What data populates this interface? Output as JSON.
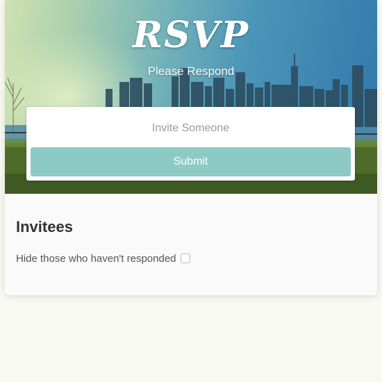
{
  "header": {
    "title": "RSVP",
    "subtitle": "Please Respond"
  },
  "invite_form": {
    "input_placeholder": "Invite Someone",
    "input_value": "",
    "submit_label": "Submit"
  },
  "invitees": {
    "heading": "Invitees",
    "hide_unresponded_label": "Hide those who haven't responded",
    "hide_unresponded_checked": false
  },
  "colors": {
    "accent": "#8ecac4",
    "page_background": "#f8faf2",
    "card_background": "#fafafa",
    "heading_text": "#333333"
  }
}
